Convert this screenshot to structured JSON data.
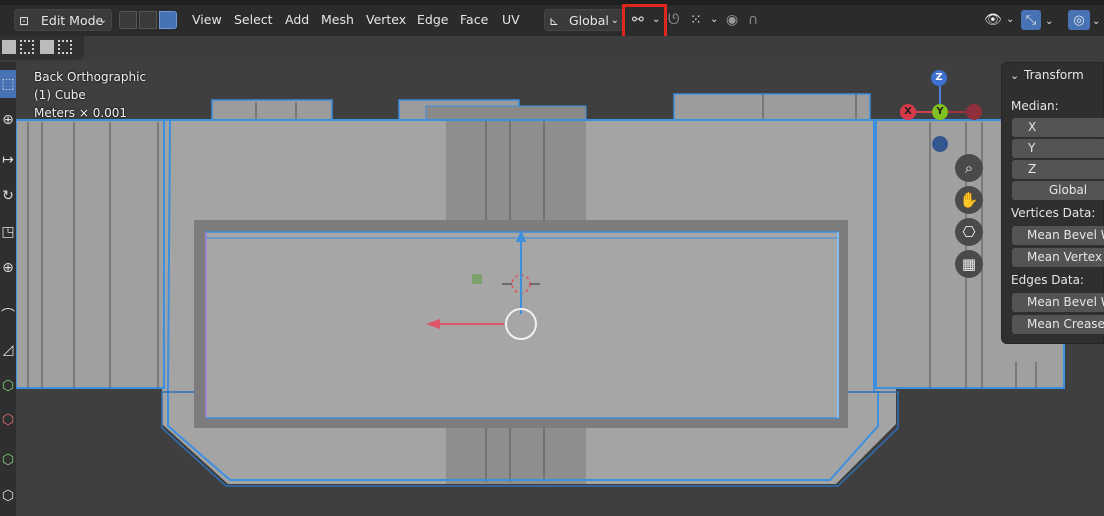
{
  "header": {
    "mode_label": "Edit Mode",
    "menus": [
      "View",
      "Select",
      "Add",
      "Mesh",
      "Vertex",
      "Edge",
      "Face",
      "UV"
    ],
    "orientation_label": "Global",
    "icons": {
      "editor_type": "editor-type-icon",
      "vertex_select": "vertex-select-icon",
      "edge_select": "edge-select-icon",
      "face_select": "face-select-icon",
      "orientation": "transform-orientation-icon",
      "pivot": "pivot-point-icon",
      "snap": "snap-icon",
      "snap_target": "snap-target-icon",
      "proportional": "proportional-edit-icon",
      "falloff": "falloff-icon",
      "visibility": "visibility-icon",
      "gizmo": "gizmo-icon",
      "overlay": "overlay-icon"
    },
    "highlight_color": "#e0271e"
  },
  "viewport": {
    "view_name": "Back Orthographic",
    "object_name": "(1) Cube",
    "units": "Meters × 0.001",
    "axes": {
      "x": "X",
      "y": "Y",
      "z": "Z"
    },
    "nav_icons": [
      "zoom-icon",
      "pan-hand-icon",
      "camera-icon",
      "grid-icon"
    ],
    "selection_color": "#3d8fe0"
  },
  "transform_panel": {
    "title": "Transform",
    "median_label": "Median:",
    "fields": [
      "X",
      "Y",
      "Z"
    ],
    "space_label": "Global",
    "vertices_label": "Vertices Data:",
    "vertex_fields": [
      "Mean Bevel W",
      "Mean Vertex C"
    ],
    "edges_label": "Edges Data:",
    "edge_fields": [
      "Mean Bevel W",
      "Mean Crease"
    ]
  }
}
